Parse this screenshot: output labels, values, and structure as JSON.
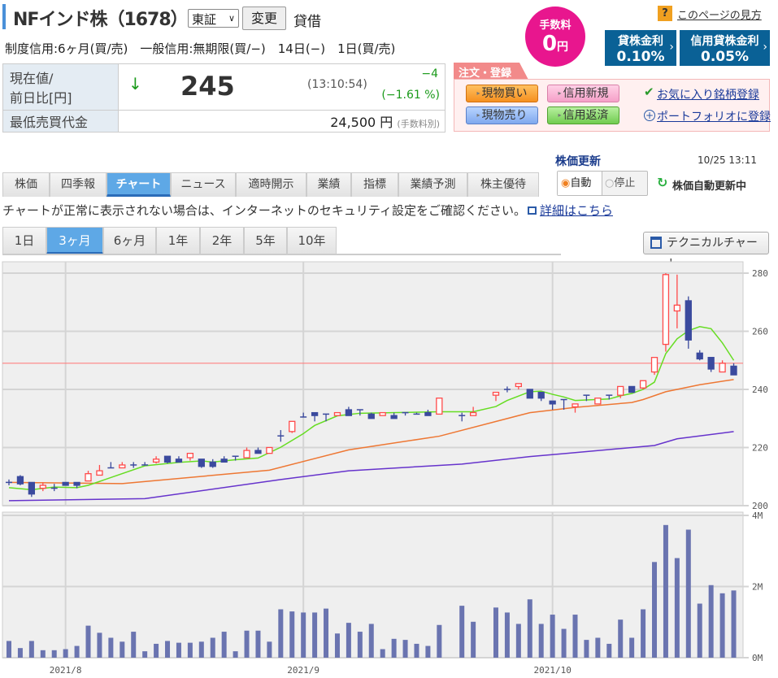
{
  "header": {
    "title": "NFインド株（1678）",
    "market_select": "東証",
    "change_button": "変更",
    "lending_label": "貸借",
    "margin_info": "制度信用:6ヶ月(買/売)　一般信用:無期限(買/−)　14日(−)　1日(買/売)",
    "fee_badge": {
      "line1": "手数料",
      "value": "0",
      "unit": "円"
    },
    "help_icon": "?",
    "help_link": "このページの見方",
    "rates": [
      {
        "label": "貸株金利",
        "value": "0.10%"
      },
      {
        "label": "信用貸株金利",
        "value": "0.05%"
      }
    ]
  },
  "price": {
    "label_line1": "現在値/",
    "label_line2": "前日比[円]",
    "arrow": "↓",
    "current": "245",
    "time": "(13:10:54)",
    "change": "−4",
    "change_pct": "(−1.61 %)",
    "min_label": "最低売買代金",
    "min_value": "24,500 円",
    "min_note": "(手数料別)",
    "down_color": "#1a9a1a"
  },
  "order": {
    "tab": "注文・登録",
    "buy_spot": "現物買い",
    "margin_new": "信用新規",
    "sell_spot": "現物売り",
    "margin_close": "信用返済",
    "favorite": "お気に入り銘柄登録",
    "portfolio": "ポートフォリオに登録"
  },
  "update": {
    "title": "株価更新",
    "time": "10/25 13:11",
    "auto": "自動",
    "stop": "停止",
    "status": "株価自動更新中"
  },
  "tabs": [
    {
      "label": "株価"
    },
    {
      "label": "四季報"
    },
    {
      "label": "チャート",
      "active": true
    },
    {
      "label": "ニュース"
    },
    {
      "label": "適時開示"
    },
    {
      "label": "業績"
    },
    {
      "label": "指標"
    },
    {
      "label": "業績予測"
    },
    {
      "label": "株主優待"
    }
  ],
  "notice": {
    "text": "チャートが正常に表示されない場合は、インターネットのセキュリティ設定をご確認ください。",
    "link": "詳細はこちら"
  },
  "periods": [
    {
      "label": "1日"
    },
    {
      "label": "3ヶ月",
      "active": true
    },
    {
      "label": "6ヶ月"
    },
    {
      "label": "1年"
    },
    {
      "label": "2年"
    },
    {
      "label": "5年"
    },
    {
      "label": "10年"
    }
  ],
  "technical_button": "テクニカルチャート",
  "chart_data": {
    "type": "candlestick",
    "price_axis": {
      "range": [
        200,
        280
      ],
      "ticks": [
        "200",
        "220",
        "240",
        "260",
        "280"
      ]
    },
    "volume_axis": {
      "range": [
        0,
        4
      ],
      "unit": "M",
      "ticks": [
        "0M",
        "2M",
        "4M"
      ]
    },
    "x_labels": [
      {
        "label": "2021/8",
        "index": 5
      },
      {
        "label": "2021/9",
        "index": 26
      },
      {
        "label": "2021/10",
        "index": 48
      }
    ],
    "prev_close": 249,
    "colors": {
      "up": "#ff4a4a",
      "down": "#3b4a9e",
      "ma_short": "#66dd22",
      "ma_mid": "#ee7733",
      "ma_long": "#6633cc",
      "volume": "#6a74b0"
    },
    "ohlc": [
      [
        208,
        209,
        207,
        208
      ],
      [
        210,
        210.5,
        207,
        207.5
      ],
      [
        208,
        208,
        203,
        204
      ],
      [
        206,
        208,
        205,
        207
      ],
      [
        206,
        207.5,
        205,
        206
      ],
      [
        208,
        208,
        207,
        207
      ],
      [
        208,
        208,
        206,
        207
      ],
      [
        208.5,
        212,
        208.5,
        211
      ],
      [
        210.5,
        214,
        210.5,
        212
      ],
      [
        213,
        215,
        213,
        213
      ],
      [
        213,
        215,
        213,
        214
      ],
      [
        214,
        215,
        213,
        214
      ],
      [
        214,
        215,
        214,
        214
      ],
      [
        215,
        217,
        214.5,
        216
      ],
      [
        217,
        217,
        214.5,
        215
      ],
      [
        216,
        217,
        215,
        215
      ],
      [
        216.5,
        218,
        215.5,
        218
      ],
      [
        216,
        216,
        213,
        213.5
      ],
      [
        215,
        216,
        213,
        213.5
      ],
      [
        216,
        217,
        215,
        215
      ],
      [
        217,
        217,
        215.5,
        217
      ],
      [
        216.5,
        220,
        216.5,
        219
      ],
      [
        219,
        220,
        218,
        218
      ],
      [
        218,
        220,
        218,
        220
      ],
      [
        224,
        226,
        222,
        224
      ],
      [
        225.5,
        229,
        225,
        229
      ],
      [
        230.5,
        232,
        230.5,
        230.5
      ],
      [
        232,
        232,
        229,
        231
      ],
      [
        231.5,
        231.5,
        229,
        231.5
      ],
      [
        231,
        232,
        231,
        232
      ],
      [
        233,
        234,
        231,
        231
      ],
      [
        233,
        233,
        231,
        233
      ],
      [
        231.5,
        232,
        230,
        230
      ],
      [
        231,
        232,
        231,
        232
      ],
      [
        231,
        232,
        230,
        230
      ],
      [
        232,
        232,
        231,
        232
      ],
      [
        231.5,
        232,
        231.5,
        231.5
      ],
      [
        232,
        233,
        231,
        231
      ],
      [
        231.5,
        237,
        231.5,
        237
      ],
      null,
      [
        231,
        232,
        229,
        231
      ],
      [
        231,
        234,
        231,
        232
      ],
      null,
      [
        238,
        239,
        236,
        239
      ],
      [
        240,
        241,
        239,
        240
      ],
      [
        241,
        242,
        240,
        242
      ],
      [
        240,
        240,
        237,
        237
      ],
      [
        239,
        239,
        236,
        237
      ],
      [
        236,
        236,
        233,
        235
      ],
      [
        236.5,
        236.5,
        233,
        236.5
      ],
      [
        234,
        235,
        232,
        235
      ],
      [
        238,
        238,
        236,
        238
      ],
      [
        235,
        237,
        235,
        237
      ],
      [
        238,
        238,
        236.5,
        238
      ],
      [
        238,
        241,
        237,
        241
      ],
      [
        241,
        241,
        239,
        239
      ],
      [
        240.5,
        243,
        240,
        243
      ],
      [
        246,
        251,
        245,
        251
      ],
      [
        255.5,
        280,
        253,
        279.5
      ],
      [
        267,
        279.5,
        261,
        269
      ],
      [
        270.5,
        272,
        254,
        257
      ],
      [
        252.5,
        253.5,
        250,
        250.5
      ],
      [
        251,
        251,
        246,
        247
      ],
      [
        246,
        250,
        246,
        249
      ],
      [
        248,
        249,
        245,
        245
      ]
    ],
    "volume": [
      0.47,
      0.27,
      0.47,
      0.21,
      0.21,
      0.24,
      0.33,
      0.9,
      0.7,
      0.56,
      0.45,
      0.73,
      0.18,
      0.39,
      0.47,
      0.42,
      0.42,
      0.45,
      0.56,
      0.73,
      0.18,
      0.76,
      0.76,
      0.45,
      1.36,
      1.3,
      1.27,
      1.27,
      1.38,
      0.68,
      0.98,
      0.73,
      0.95,
      0.24,
      0.53,
      0.5,
      0.39,
      0.33,
      0.92,
      null,
      1.46,
      1.01,
      null,
      1.41,
      1.27,
      0.95,
      1.64,
      0.95,
      1.21,
      0.81,
      1.21,
      0.5,
      0.56,
      0.39,
      1.07,
      0.56,
      1.36,
      2.69,
      3.73,
      2.8,
      3.6,
      1.52,
      2.04,
      1.81,
      1.89
    ],
    "ma_short": [
      [
        0,
        206.2
      ],
      [
        2,
        205.5
      ],
      [
        4,
        206.4
      ],
      [
        6,
        206.2
      ],
      [
        7,
        207
      ],
      [
        12,
        213.7
      ],
      [
        15,
        214.9
      ],
      [
        17,
        215.4
      ],
      [
        18,
        215
      ],
      [
        20,
        215.8
      ],
      [
        22,
        216.4
      ],
      [
        24,
        220.1
      ],
      [
        26,
        224.8
      ],
      [
        27,
        227.6
      ],
      [
        29,
        230.9
      ],
      [
        31,
        231.8
      ],
      [
        38,
        232.3
      ],
      [
        41,
        232.3
      ],
      [
        43,
        234.1
      ],
      [
        44,
        236.2
      ],
      [
        46,
        239.2
      ],
      [
        47,
        239.4
      ],
      [
        48,
        238.3
      ],
      [
        49,
        237.4
      ],
      [
        50,
        236.2
      ],
      [
        53,
        236.7
      ],
      [
        54,
        237.8
      ],
      [
        55,
        238.6
      ],
      [
        56,
        240
      ],
      [
        57,
        242.5
      ],
      [
        58,
        252.3
      ],
      [
        59,
        257.4
      ],
      [
        60,
        260.2
      ],
      [
        61,
        261.6
      ],
      [
        62,
        260.9
      ],
      [
        63,
        256
      ],
      [
        64,
        250
      ]
    ],
    "ma_mid": [
      [
        0,
        208
      ],
      [
        10,
        207.6
      ],
      [
        23,
        212.2
      ],
      [
        30,
        219.2
      ],
      [
        38,
        223.9
      ],
      [
        46,
        232
      ],
      [
        50,
        233.8
      ],
      [
        55,
        235.5
      ],
      [
        56,
        236.5
      ],
      [
        58,
        239.2
      ],
      [
        61,
        241.6
      ],
      [
        64,
        243.4
      ]
    ],
    "ma_long": [
      [
        0,
        201.7
      ],
      [
        12,
        202.4
      ],
      [
        24,
        209
      ],
      [
        30,
        212
      ],
      [
        40,
        214.3
      ],
      [
        46,
        216.9
      ],
      [
        49,
        217.9
      ],
      [
        57,
        220.7
      ],
      [
        59,
        223
      ],
      [
        64,
        225.5
      ]
    ]
  }
}
